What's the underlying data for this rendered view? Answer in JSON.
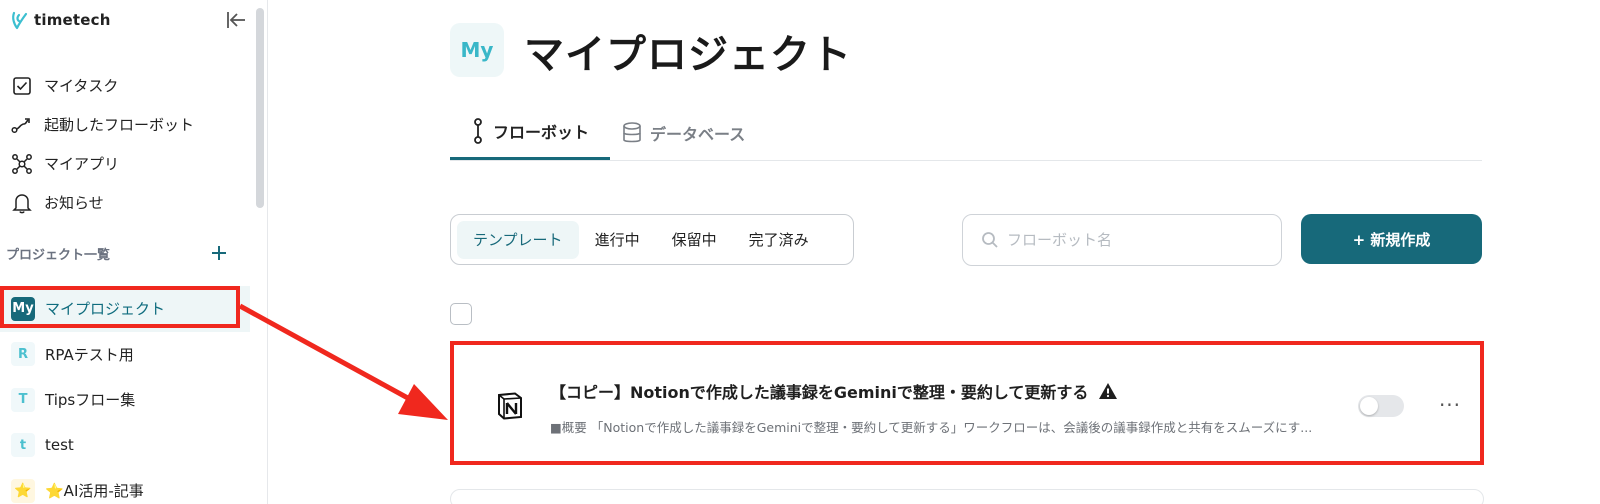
{
  "app": {
    "name": "timetech"
  },
  "sidebar": {
    "nav": [
      {
        "label": "マイタスク",
        "icon": "checkbox-icon"
      },
      {
        "label": "起動したフローボット",
        "icon": "route-icon"
      },
      {
        "label": "マイアプリ",
        "icon": "apps-network-icon"
      },
      {
        "label": "お知らせ",
        "icon": "bell-icon"
      }
    ],
    "projects_title": "プロジェクト一覧",
    "projects": [
      {
        "badge": "My",
        "label": "マイプロジェクト",
        "active": true
      },
      {
        "badge": "R",
        "label": "RPAテスト用",
        "active": false
      },
      {
        "badge": "T",
        "label": "Tipsフロー集",
        "active": false
      },
      {
        "badge": "t",
        "label": "test",
        "active": false
      },
      {
        "badge": "⭐",
        "label": "⭐AI活用-記事",
        "active": false
      }
    ]
  },
  "main": {
    "avatar": "My",
    "title": "マイプロジェクト",
    "tabs": [
      {
        "label": "フローボット",
        "active": true
      },
      {
        "label": "データベース",
        "active": false
      }
    ],
    "filters": [
      "テンプレート",
      "進行中",
      "保留中",
      "完了済み"
    ],
    "active_filter": "テンプレート",
    "search_placeholder": "フローボット名",
    "new_button": "+ 新規作成",
    "flows": [
      {
        "title": "【コピー】Notionで作成した議事録をGeminiで整理・要約して更新する",
        "description": "■概要 「Notionで作成した議事録をGeminiで整理・要約して更新する」ワークフローは、会議後の議事録作成と共有をスムーズにす...",
        "enabled": false,
        "app_icon": "notion-icon",
        "warning": true
      }
    ]
  },
  "annotation": {
    "highlight_color": "#f0281e"
  },
  "colors": {
    "accent": "#17697a",
    "accent_light": "#eef6f7",
    "badge_text": "#4cc0cf"
  }
}
